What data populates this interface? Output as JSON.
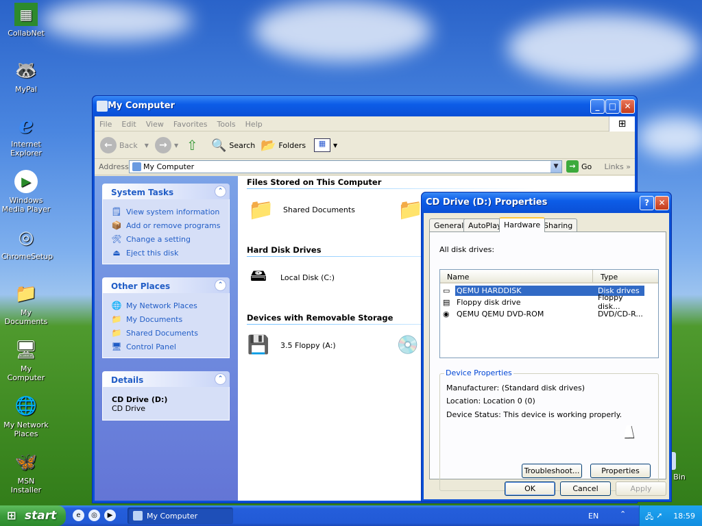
{
  "desktop": {
    "icons": [
      {
        "label": "CollabNet",
        "glyph": "▦"
      },
      {
        "label": "MyPal",
        "glyph": "🦝"
      },
      {
        "label": "Internet Explorer",
        "glyph": "ℯ"
      },
      {
        "label": "Windows Media Player",
        "glyph": "▶"
      },
      {
        "label": "ChromeSetup",
        "glyph": "◎"
      },
      {
        "label": "My Documents",
        "glyph": "📁"
      },
      {
        "label": "My Computer",
        "glyph": "🖥"
      },
      {
        "label": "My Network Places",
        "glyph": "🌐"
      },
      {
        "label": "MSN Installer",
        "glyph": "🦋"
      }
    ],
    "recycle_partial": "e Bin"
  },
  "explorer": {
    "title": "My Computer",
    "menu": [
      "File",
      "Edit",
      "View",
      "Favorites",
      "Tools",
      "Help"
    ],
    "toolbar": {
      "back": "Back",
      "search": "Search",
      "folders": "Folders"
    },
    "address": {
      "label": "Address",
      "value": "My Computer",
      "go": "Go",
      "links": "Links"
    },
    "panels": {
      "system_tasks": {
        "title": "System Tasks",
        "items": [
          "View system information",
          "Add or remove programs",
          "Change a setting",
          "Eject this disk"
        ]
      },
      "other_places": {
        "title": "Other Places",
        "items": [
          "My Network Places",
          "My Documents",
          "Shared Documents",
          "Control Panel"
        ]
      },
      "details": {
        "title": "Details",
        "name": "CD Drive (D:)",
        "type": "CD Drive"
      }
    },
    "groups": {
      "files": {
        "title": "Files Stored on This Computer",
        "items": [
          "Shared Documents"
        ]
      },
      "hdd": {
        "title": "Hard Disk Drives",
        "items": [
          "Local Disk (C:)"
        ]
      },
      "removable": {
        "title": "Devices with Removable Storage",
        "items": [
          "3.5 Floppy (A:)"
        ]
      }
    }
  },
  "dialog": {
    "title": "CD Drive (D:) Properties",
    "tabs": [
      "General",
      "AutoPlay",
      "Hardware",
      "Sharing"
    ],
    "active_tab": "Hardware",
    "all_drives_label": "All disk drives:",
    "columns": [
      "Name",
      "Type"
    ],
    "rows": [
      {
        "name": "QEMU HARDDISK",
        "type": "Disk drives",
        "selected": true
      },
      {
        "name": "Floppy disk drive",
        "type": "Floppy disk..."
      },
      {
        "name": "QEMU QEMU DVD-ROM",
        "type": "DVD/CD-R..."
      }
    ],
    "device_properties": {
      "legend": "Device Properties",
      "manufacturer": "Manufacturer: (Standard disk drives)",
      "location": "Location: Location 0 (0)",
      "status": "Device Status: This device is working properly."
    },
    "buttons": {
      "troubleshoot": "Troubleshoot...",
      "properties": "Properties",
      "ok": "OK",
      "cancel": "Cancel",
      "apply": "Apply"
    }
  },
  "taskbar": {
    "start": "start",
    "task": "My Computer",
    "lang": "EN",
    "clock": "18:59"
  }
}
